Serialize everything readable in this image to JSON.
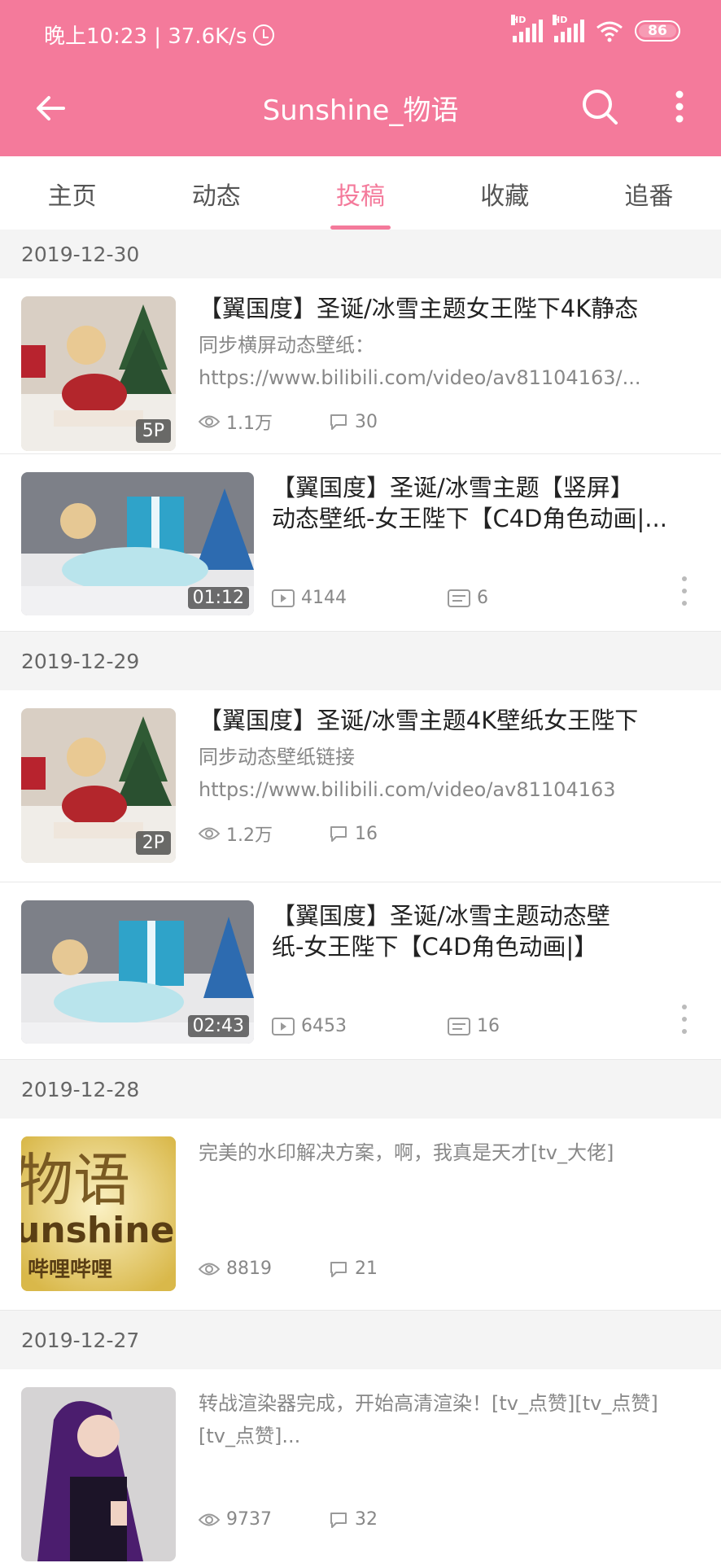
{
  "status_bar": {
    "time_speed": "晚上10:23 | 37.6K/s",
    "battery": "86",
    "signal_label": "HD",
    "icons": [
      "alarm-icon",
      "signal-icon",
      "signal-icon",
      "wifi-icon",
      "battery-icon"
    ]
  },
  "app_bar": {
    "title": "Sunshine_物语",
    "icons": [
      "back-arrow-icon",
      "search-icon",
      "more-vert-icon"
    ]
  },
  "tabs": [
    "主页",
    "动态",
    "投稿",
    "收藏",
    "追番"
  ],
  "active_tab": "投稿",
  "accent_color": "#f47a9b",
  "feed": {
    "dates": [
      "2019-12-30",
      "2019-12-29",
      "2019-12-28",
      "2019-12-27"
    ],
    "posts": [
      {
        "title": "【翼国度】圣诞/冰雪主题女王陛下4K静态",
        "desc_line1": "同步横屏动态壁纸：",
        "desc_line2": "https://www.bilibili.com/video/av81104163/...",
        "badge": "5P",
        "views": "1.1万",
        "comments": "30"
      },
      {
        "title_line1": "【翼国度】圣诞/冰雪主题【竖屏】",
        "title_line2": "动态壁纸-女王陛下【C4D角色动画|...",
        "duration": "01:12",
        "plays": "4144",
        "danmaku": "6"
      },
      {
        "title": "【翼国度】圣诞/冰雪主题4K壁纸女王陛下",
        "desc_line1": "同步动态壁纸链接",
        "desc_line2": "https://www.bilibili.com/video/av81104163",
        "badge": "2P",
        "views": "1.2万",
        "comments": "16"
      },
      {
        "title_line1": "【翼国度】圣诞/冰雪主题动态壁",
        "title_line2": "纸-女王陛下【C4D角色动画|】",
        "duration": "02:43",
        "plays": "6453",
        "danmaku": "16"
      },
      {
        "desc_line1": "完美的水印解决方案，啊，我真是天才[tv_大佬]",
        "thumb_text_1": "物语",
        "thumb_text_2": "unshine",
        "thumb_text_3": "哔哩哔哩",
        "views": "8819",
        "comments": "21"
      },
      {
        "desc_line1": "转战渲染器完成，开始高清渲染！[tv_点赞][tv_点赞]",
        "desc_line2": "[tv_点赞]...",
        "views": "9737",
        "comments": "32"
      }
    ]
  }
}
